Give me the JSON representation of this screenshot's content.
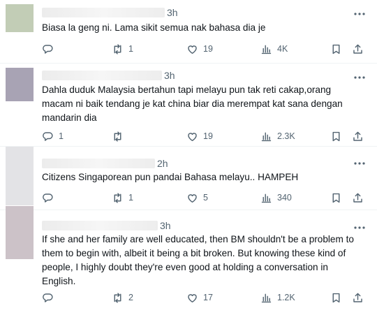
{
  "posts": [
    {
      "time": "3h",
      "text": "Biasa la geng ni. Lama sikit semua nak bahasa dia je",
      "replies": "",
      "reposts": "1",
      "likes": "19",
      "views": "4K",
      "avatar_color": "#c2cdb6"
    },
    {
      "time": "3h",
      "text": "Dahla duduk Malaysia bertahun tapi melayu pun tak reti cakap,orang macam ni baik tendang je kat china biar dia merempat kat sana dengan mandarin dia",
      "replies": "1",
      "reposts": "",
      "likes": "19",
      "views": "2.3K",
      "avatar_color": "#a8a3b4"
    },
    {
      "time": "2h",
      "text": "Citizens Singaporean pun pandai Bahasa melayu.. HAMPEH",
      "replies": "",
      "reposts": "1",
      "likes": "5",
      "views": "340",
      "avatar_color": "#e3e3e6"
    },
    {
      "time": "3h",
      "text": "If she and her family are well educated, then BM shouldn't be a problem to them to begin with, albeit it being a bit broken. But knowing these kind of people, I highly doubt they're even good at holding a conversation in English.",
      "replies": "",
      "reposts": "2",
      "likes": "17",
      "views": "1.2K",
      "avatar_color": "#ccc2c8"
    }
  ],
  "icons": {
    "more": "more-icon",
    "reply": "reply-icon",
    "repost": "repost-icon",
    "like": "like-icon",
    "views": "views-icon",
    "bookmark": "bookmark-icon",
    "share": "share-icon"
  }
}
